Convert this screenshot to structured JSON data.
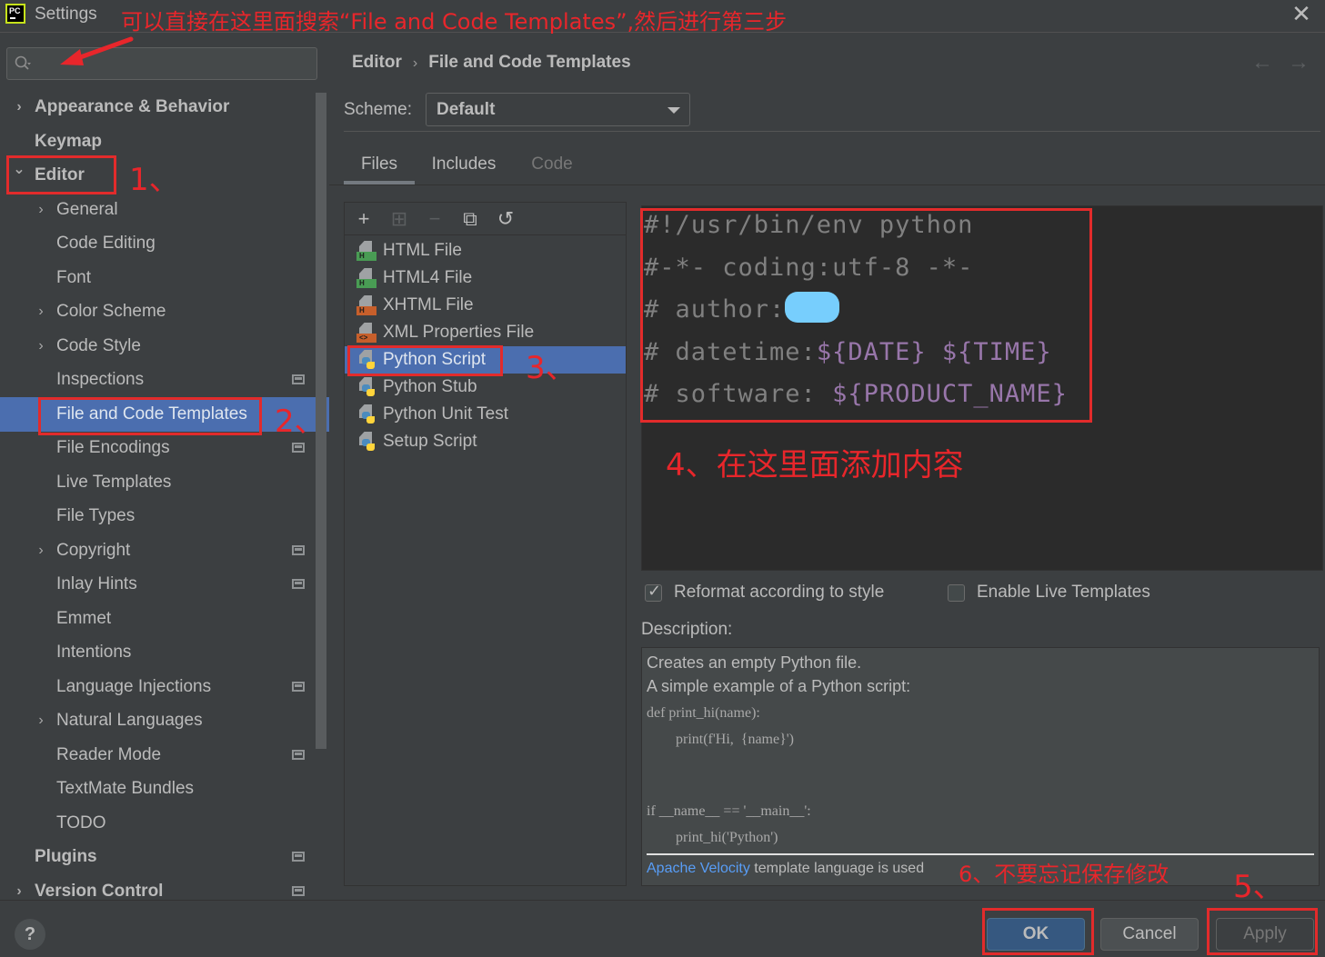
{
  "window": {
    "title": "Settings",
    "app_logo_text": "PC",
    "close_glyph": "✕"
  },
  "annotations": {
    "search_hint": "可以直接在这里面搜索“File and Code Templates”,然后进行第三步",
    "step1": "1、",
    "step2": "2、",
    "step3": "3、",
    "step4": "4、在这里面添加内容",
    "step5": "5、",
    "step6": "6、不要忘记保存修改",
    "color": "#e8262b"
  },
  "search": {
    "placeholder": "",
    "value": ""
  },
  "sidebar": {
    "items": [
      {
        "label": "Appearance & Behavior",
        "level": 0,
        "bold": true,
        "chevron": "right"
      },
      {
        "label": "Keymap",
        "level": 0,
        "bold": true,
        "chevron": null
      },
      {
        "label": "Editor",
        "level": 0,
        "bold": true,
        "chevron": "down"
      },
      {
        "label": "General",
        "level": 1,
        "chevron": "right"
      },
      {
        "label": "Code Editing",
        "level": 1
      },
      {
        "label": "Font",
        "level": 1
      },
      {
        "label": "Color Scheme",
        "level": 1,
        "chevron": "right"
      },
      {
        "label": "Code Style",
        "level": 1,
        "chevron": "right"
      },
      {
        "label": "Inspections",
        "level": 1,
        "project_icon": true
      },
      {
        "label": "File and Code Templates",
        "level": 1,
        "selected": true
      },
      {
        "label": "File Encodings",
        "level": 1,
        "project_icon": true
      },
      {
        "label": "Live Templates",
        "level": 1
      },
      {
        "label": "File Types",
        "level": 1
      },
      {
        "label": "Copyright",
        "level": 1,
        "chevron": "right",
        "project_icon": true
      },
      {
        "label": "Inlay Hints",
        "level": 1,
        "project_icon": true
      },
      {
        "label": "Emmet",
        "level": 1
      },
      {
        "label": "Intentions",
        "level": 1
      },
      {
        "label": "Language Injections",
        "level": 1,
        "project_icon": true
      },
      {
        "label": "Natural Languages",
        "level": 1,
        "chevron": "right"
      },
      {
        "label": "Reader Mode",
        "level": 1,
        "project_icon": true
      },
      {
        "label": "TextMate Bundles",
        "level": 1
      },
      {
        "label": "TODO",
        "level": 1
      },
      {
        "label": "Plugins",
        "level": 0,
        "bold": true,
        "project_icon": true
      },
      {
        "label": "Version Control",
        "level": 0,
        "bold": true,
        "chevron": "right",
        "project_icon": true
      }
    ]
  },
  "breadcrumb": {
    "parent": "Editor",
    "separator": "›",
    "current": "File and Code Templates",
    "back_glyph": "←",
    "forward_glyph": "→"
  },
  "scheme": {
    "label": "Scheme:",
    "value": "Default"
  },
  "tabs": [
    {
      "label": "Files",
      "active": true
    },
    {
      "label": "Includes"
    },
    {
      "label": "Code",
      "disabled": true
    }
  ],
  "toolbar": {
    "add": "+",
    "add_child": "⊞",
    "remove": "−",
    "copy": "⧉",
    "reset": "↺"
  },
  "templates": [
    {
      "label": "HTML File",
      "icon": "html",
      "badge": "H",
      "badge_color": "#499c54"
    },
    {
      "label": "HTML4 File",
      "icon": "html",
      "badge": "H",
      "badge_color": "#499c54"
    },
    {
      "label": "XHTML File",
      "icon": "html",
      "badge": "H",
      "badge_color": "#c75f2b"
    },
    {
      "label": "XML Properties File",
      "icon": "xml",
      "badge": "<>",
      "badge_color": "#c75f2b"
    },
    {
      "label": "Python Script",
      "icon": "python",
      "selected": true
    },
    {
      "label": "Python Stub",
      "icon": "python"
    },
    {
      "label": "Python Unit Test",
      "icon": "python"
    },
    {
      "label": "Setup Script",
      "icon": "python"
    }
  ],
  "editor": {
    "lines": [
      {
        "text": "#!/usr/bin/env python"
      },
      {
        "text": "#-*- coding:utf-8 -*-"
      },
      {
        "text": "# author:",
        "redacted": true
      },
      {
        "text": "# datetime:",
        "vars": [
          "${DATE}",
          " ",
          "${TIME}"
        ]
      },
      {
        "text": "# software: ",
        "vars": [
          "${PRODUCT_NAME}"
        ]
      }
    ],
    "comment_color": "#808080",
    "variable_color": "#9876aa"
  },
  "options": {
    "reformat": {
      "label": "Reformat according to style",
      "checked": true
    },
    "live_templates": {
      "label": "Enable Live Templates",
      "checked": false
    }
  },
  "description": {
    "label": "Description:",
    "line1": "Creates an empty Python file.",
    "line2": "A simple example of a Python script:",
    "code": [
      "def print_hi(name):",
      "        print(f'Hi,  {name}')",
      "",
      "",
      "if __name__ == '__main__':",
      "        print_hi('Python')"
    ],
    "footer_link": "Apache Velocity",
    "footer_text": " template language is used"
  },
  "buttons": {
    "help": "?",
    "ok": "OK",
    "cancel": "Cancel",
    "apply": "Apply"
  },
  "colors": {
    "selection": "#4b6eaf",
    "ok_button": "#365880",
    "link": "#589df6"
  }
}
